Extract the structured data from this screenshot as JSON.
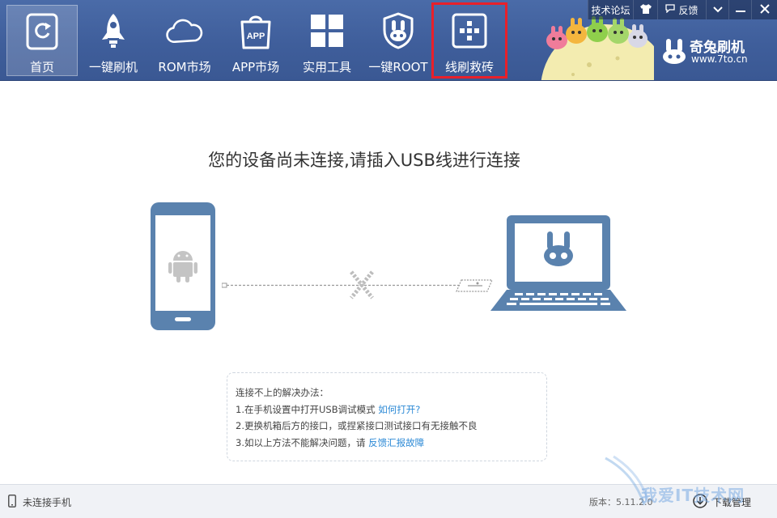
{
  "topbar": {
    "forum": "技术论坛",
    "feedback": "反馈"
  },
  "nav": [
    {
      "label": "首页",
      "icon": "home-refresh-icon"
    },
    {
      "label": "一键刷机",
      "icon": "rocket-icon"
    },
    {
      "label": "ROM市场",
      "icon": "cloud-icon"
    },
    {
      "label": "APP市场",
      "icon": "app-bag-icon"
    },
    {
      "label": "实用工具",
      "icon": "grid-icon"
    },
    {
      "label": "一键ROOT",
      "icon": "rabbit-shield-icon"
    },
    {
      "label": "线刷救砖",
      "icon": "cross-plus-icon"
    }
  ],
  "app_icon_text": "APP",
  "brand": {
    "name": "奇兔刷机",
    "url": "www.7to.cn"
  },
  "main": {
    "prompt": "您的设备尚未连接,请插入USB线进行连接",
    "tips": {
      "title": "连接不上的解决办法：",
      "line1_text": "1.在手机设置中打开USB调试模式 ",
      "line1_link": "如何打开?",
      "line2_text": "2.更换机箱后方的接口，或捏紧接口测试接口有无接触不良",
      "line3_text": "3.如以上方法不能解决问题，请 ",
      "line3_link": "反馈汇报故障"
    }
  },
  "status": {
    "device": "未连接手机",
    "version": "版本：5.11.2.0",
    "download": "下载管理"
  },
  "watermark": {
    "text": "我爱IT技术网"
  },
  "colors": {
    "header": "#3f5e9b",
    "device_blue": "#5a82ae",
    "highlight_red": "#e8202a",
    "link_blue": "#2d8ad6"
  }
}
